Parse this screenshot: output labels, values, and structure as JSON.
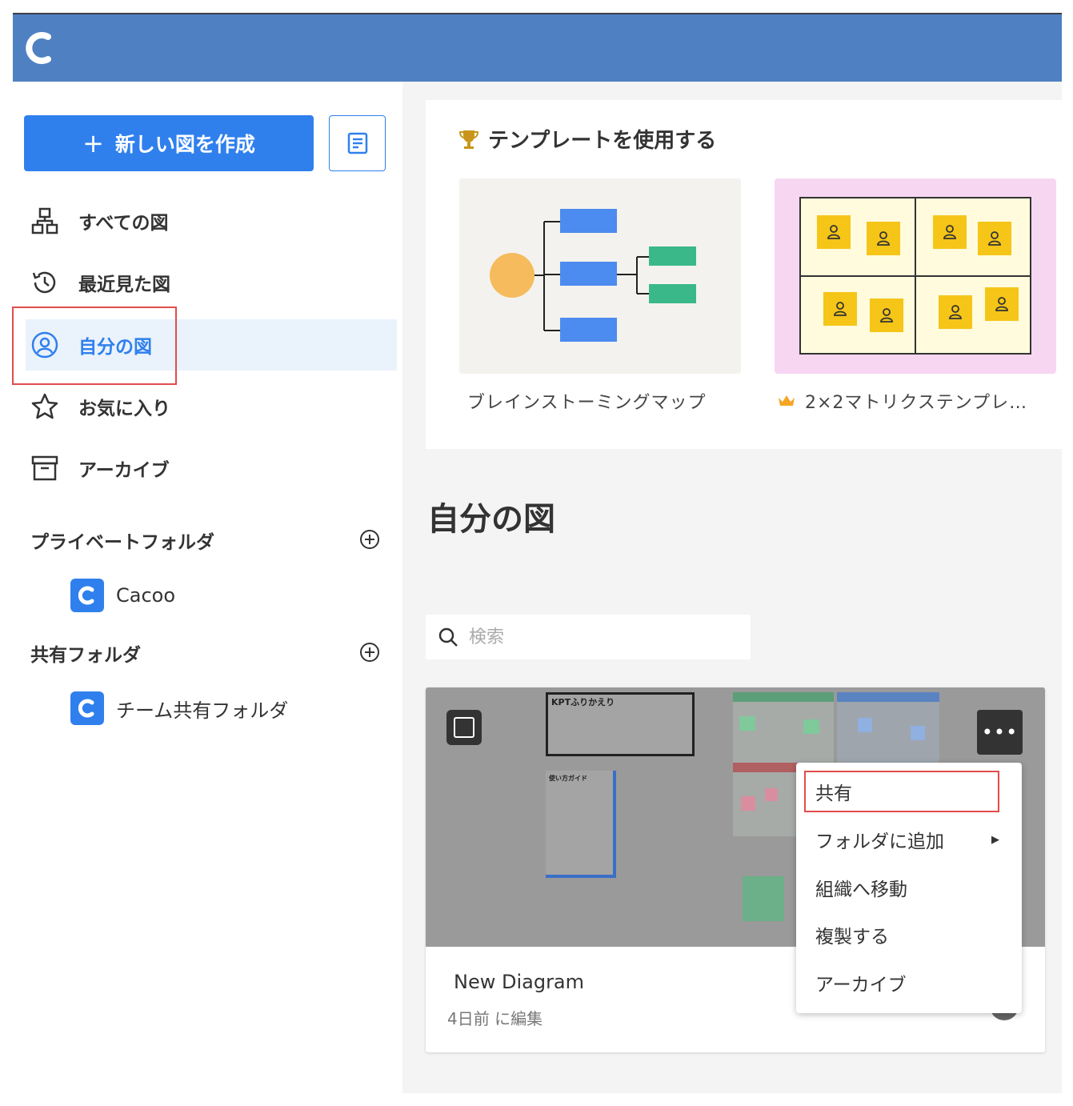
{
  "sidebar": {
    "new_button_label": "新しい図を作成",
    "nav": [
      {
        "label": "すべての図"
      },
      {
        "label": "最近見た図"
      },
      {
        "label": "自分の図"
      },
      {
        "label": "お気に入り"
      },
      {
        "label": "アーカイブ"
      }
    ],
    "private_section": "プライベートフォルダ",
    "private_folders": [
      {
        "label": "Cacoo"
      }
    ],
    "shared_section": "共有フォルダ",
    "shared_folders": [
      {
        "label": "チーム共有フォルダ"
      }
    ]
  },
  "templates": {
    "title": "テンプレートを使用する",
    "items": [
      {
        "label": "ブレインストーミングマップ"
      },
      {
        "label": "2×2マトリクステンプレ…"
      }
    ]
  },
  "main": {
    "page_title": "自分の図",
    "search_placeholder": "検索"
  },
  "diagram": {
    "name": "New Diagram",
    "meta": "4日前 に編集",
    "thumb_text_1": "KPTふりかえり",
    "thumb_text_2": "使い方ガイド",
    "more_label": "•••"
  },
  "context_menu": {
    "items": [
      {
        "label": "共有"
      },
      {
        "label": "フォルダに追加"
      },
      {
        "label": "組織へ移動"
      },
      {
        "label": "複製する"
      },
      {
        "label": "アーカイブ"
      }
    ]
  },
  "colors": {
    "header": "#4f81c2",
    "accent": "#2f80ed",
    "highlight": "#e24c4c"
  }
}
